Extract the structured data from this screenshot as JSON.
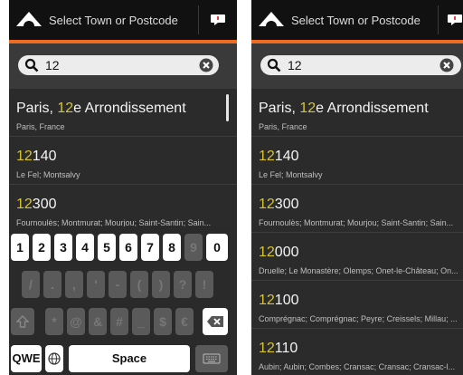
{
  "header": {
    "title": "Select Town or Postcode"
  },
  "search": {
    "value": "12"
  },
  "results": [
    {
      "highlight": "",
      "name_rest": "",
      "prefix": "Paris, ",
      "hl": "12",
      "suffix": "e Arrondissement",
      "sub": "Paris, France"
    },
    {
      "prefix": "",
      "hl": "12",
      "suffix": "140",
      "sub": "Le Fel; Montsalvy"
    },
    {
      "prefix": "",
      "hl": "12",
      "suffix": "300",
      "sub": "Fournoulès; Montmurat; Mourjou; Saint-Santin; Sain..."
    },
    {
      "prefix": "",
      "hl": "12",
      "suffix": "000",
      "sub": "Druelle; Le Monastère; Olemps; Onet-le-Château; On..."
    },
    {
      "prefix": "",
      "hl": "12",
      "suffix": "100",
      "sub": "Comprégnac; Comprégnac; Peyre; Creissels; Millau; ..."
    },
    {
      "prefix": "",
      "hl": "12",
      "suffix": "110",
      "sub": "Aubin; Aubin; Combes; Cransac; Cransac; Cransac-l..."
    }
  ],
  "keyboard": {
    "numbers": [
      "1",
      "2",
      "3",
      "4",
      "5",
      "6",
      "7",
      "8",
      "9",
      "0"
    ],
    "symbols": [
      "/",
      ".",
      ",",
      "'",
      "-",
      "(",
      ")",
      "?",
      "!"
    ],
    "row3": [
      "*",
      "@",
      "&",
      "#",
      "_",
      "$",
      "€"
    ],
    "mode_label": "QWE",
    "space_label": "Space"
  },
  "colors": {
    "accent": "#f06a20",
    "highlight": "#d8c431"
  }
}
